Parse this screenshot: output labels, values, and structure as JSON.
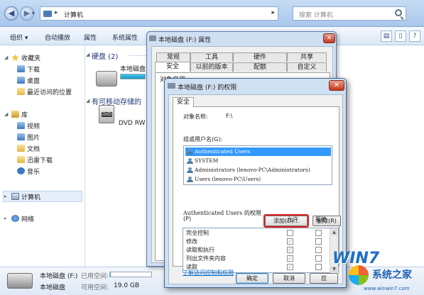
{
  "explorer": {
    "address": "计算机",
    "search_placeholder": "搜索 计算机",
    "toolbar": [
      "组织 ▾",
      "自动播放",
      "属性",
      "系统属性",
      "卸"
    ],
    "sidebar": {
      "favorites": "收藏夹",
      "fav_items": [
        "下载",
        "桌面",
        "最近访问的位置"
      ],
      "library": "库",
      "lib_items": [
        "视频",
        "图片",
        "文档",
        "迅雷下载",
        "音乐"
      ],
      "computer": "计算机",
      "network": "网络"
    },
    "groups": {
      "hard_disk": "硬盘 (2)",
      "removable": "有可移动存储的"
    },
    "drives": {
      "local_partial": "本地磁盘 (",
      "dvd": "DVD RW 驱",
      "dvd_label": "DVD"
    },
    "status": {
      "drive_name": "本地磁盘 (F:)",
      "used_label": "已用空间:",
      "drive_type": "本地磁盘",
      "free_label": "可用空间:",
      "free_value": "19.0 GB",
      "used_fraction": 0.02
    }
  },
  "properties": {
    "title": "本地磁盘 (F:) 属性",
    "tabs_row1": [
      "常规",
      "工具",
      "硬件",
      "共享"
    ],
    "tabs_row2": [
      "安全",
      "以前的版本",
      "配额",
      "自定义"
    ],
    "object_label_partial": "对象名称"
  },
  "permissions": {
    "title": "本地磁盘 (F:) 的权限",
    "tab": "安全",
    "object_label": "对象名称:",
    "object_value": "F:\\",
    "groups_label": "组或用户名(G):",
    "users": [
      "Authenticated Users",
      "SYSTEM",
      "Administrators (lenovo-PC\\Administrators)",
      "Users (lenovo-PC\\Users)"
    ],
    "add_button": "添加(D)...",
    "remove_button": "删除(R)",
    "perm_for": "Authenticated Users 的权限",
    "perm_for_key": "(P)",
    "allow": "允许",
    "deny": "拒绝",
    "perm_rows": [
      "完全控制",
      "修改",
      "读取和执行",
      "列出文件夹内容",
      "读取"
    ],
    "allow_checked": [
      false,
      true,
      true,
      true,
      true
    ],
    "link": "了解访问控制和权限",
    "ok": "确定",
    "cancel": "取消",
    "apply": "应"
  },
  "watermark": {
    "win": "WIN7",
    "brand": "系统之家",
    "url": "www.winwin7.com"
  },
  "colors": {
    "selection": "#3399ff",
    "highlight_border": "#e02020",
    "link": "#0066cc"
  }
}
